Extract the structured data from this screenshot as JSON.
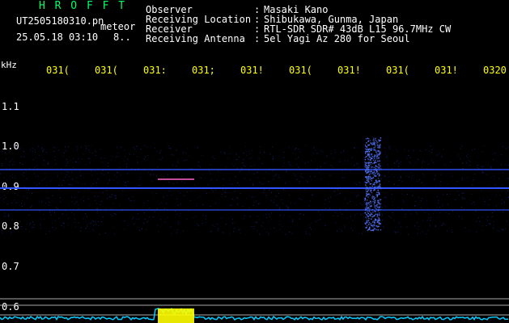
{
  "logo": "H R O F F T",
  "file": {
    "name": "UT2505180310.pn",
    "mode": "meteor",
    "datetime": "25.05.18 03:10",
    "count": "8.."
  },
  "header": {
    "rows": [
      {
        "label": "Observer",
        "value": "Masaki Kano"
      },
      {
        "label": "Receiving Location",
        "value": "Shibukawa, Gunma, Japan"
      },
      {
        "label": "Receiver",
        "value": "RTL-SDR SDR# 43dB L15 96.7MHz CW"
      },
      {
        "label": "Receiving Antenna",
        "value": "5el Yagi Az 280 for Seoul"
      }
    ]
  },
  "axis": {
    "unit": "kHz",
    "time_ticks": [
      "031(",
      "031(",
      "031:",
      "031;",
      "031!",
      "031(",
      "031!",
      "031(",
      "031!",
      "0320"
    ],
    "freq_ticks": [
      "1.1",
      "1.0",
      "0.9",
      "0.8",
      "0.7",
      "0.6"
    ]
  },
  "colors": {
    "background": "#000000",
    "logo": "#00ff66",
    "labels": "#ffffff",
    "ticks": "#ffff00",
    "signal": "#2a4cff",
    "noise_trace": "#00ccff"
  }
}
